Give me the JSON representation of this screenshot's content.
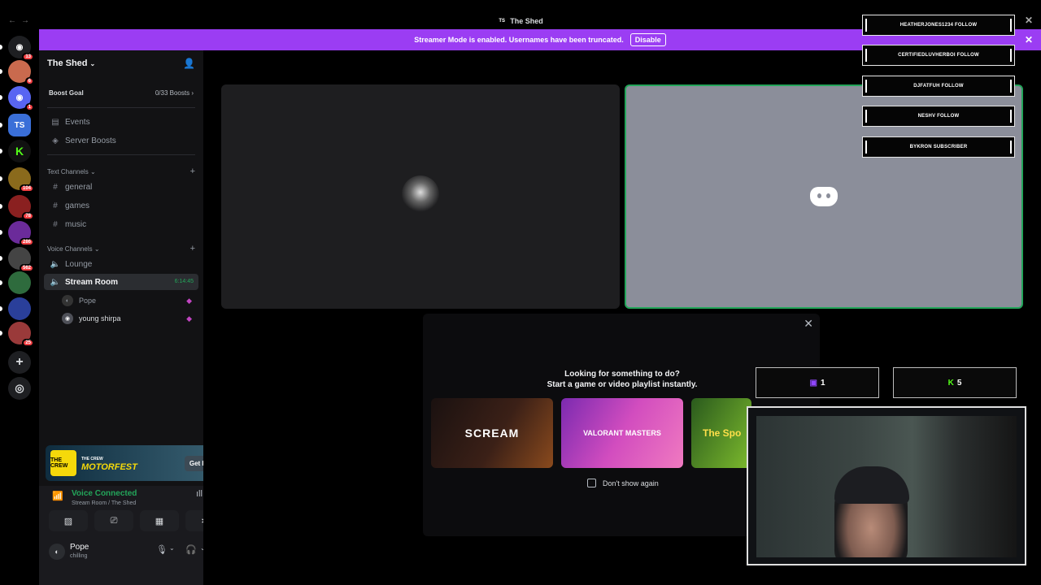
{
  "titlebar": {
    "title": "The Shed",
    "nav": "←→",
    "close": "✕",
    "server_abbr": "TS"
  },
  "banner": {
    "message": "Streamer Mode is enabled. Usernames have been truncated.",
    "disable_label": "Disable",
    "close": "✕"
  },
  "rail": {
    "servers": [
      {
        "name": "direct-messages",
        "badge": "13",
        "color": "#1e1f22",
        "glyph": "◉"
      },
      {
        "name": "server-1",
        "badge": "6",
        "color": "#c96a4e",
        "glyph": ""
      },
      {
        "name": "server-2",
        "badge": "1",
        "color": "#5865f2",
        "glyph": "◉"
      },
      {
        "name": "server-the-shed",
        "badge": "",
        "color": "#3a6fd8",
        "glyph": "TS"
      },
      {
        "name": "server-kick",
        "badge": "",
        "color": "#111",
        "glyph": "K"
      },
      {
        "name": "server-3",
        "badge": "104",
        "color": "#8a6a1c",
        "glyph": ""
      },
      {
        "name": "server-4",
        "badge": "78",
        "color": "#8a2020",
        "glyph": ""
      },
      {
        "name": "server-5",
        "badge": "286",
        "color": "#6b2b9a",
        "glyph": ""
      },
      {
        "name": "server-6",
        "badge": "562",
        "color": "#444",
        "glyph": ""
      },
      {
        "name": "server-7",
        "badge": "",
        "color": "#2e6b3d",
        "glyph": ""
      },
      {
        "name": "server-8",
        "badge": "",
        "color": "#2a3f9a",
        "glyph": ""
      },
      {
        "name": "server-9",
        "badge": "25",
        "color": "#9a3a3a",
        "glyph": ""
      }
    ],
    "add_icon": "+",
    "explore_icon": "◎"
  },
  "sidebar": {
    "server_name": "The Shed",
    "chevron": "⌄",
    "invite_icon": "👤",
    "boost_goal": "Boost Goal",
    "boost_count": "0/33 Boosts",
    "boost_chevron": "›",
    "events": "Events",
    "server_boosts": "Server Boosts",
    "text_category": "Text Channels",
    "text_channels": [
      "general",
      "games",
      "music"
    ],
    "voice_category": "Voice Channels",
    "voice_channels": [
      "Lounge",
      "Stream Room"
    ],
    "stream_timer": "6:14:45",
    "voice_users": [
      "Pope",
      "young shirpa"
    ]
  },
  "promo": {
    "game": "MOTORFEST",
    "subtitle": "THE CREW",
    "logo_text": "THE CREW",
    "cta": "Get Reward!"
  },
  "voice_panel": {
    "status": "Voice Connected",
    "location": "Stream Room / The Shed",
    "username": "Pope",
    "user_status": "chilling"
  },
  "modal": {
    "title_line1": "Looking for something to do?",
    "title_line2": "Start a game or video playlist instantly.",
    "cards": [
      "SCREAM",
      "VALORANT MASTERS",
      "The Spo"
    ],
    "dont_show": "Don't show again",
    "close": "✕"
  },
  "overlay": {
    "alerts": [
      "HEATHERJONES1234 FOLLOW",
      "CERTIFIEDLUVHERBOI FOLLOW",
      "DJFATFUH FOLLOW",
      "NESHV FOLLOW",
      "BYKRON SUBSCRIBER"
    ],
    "twitch_count": "1",
    "kick_count": "5",
    "twitch_icon": "▣",
    "kick_icon": "K"
  },
  "colors": {
    "accent": "#9b3df3",
    "voice_green": "#23a55a",
    "badge_red": "#f23f43"
  }
}
